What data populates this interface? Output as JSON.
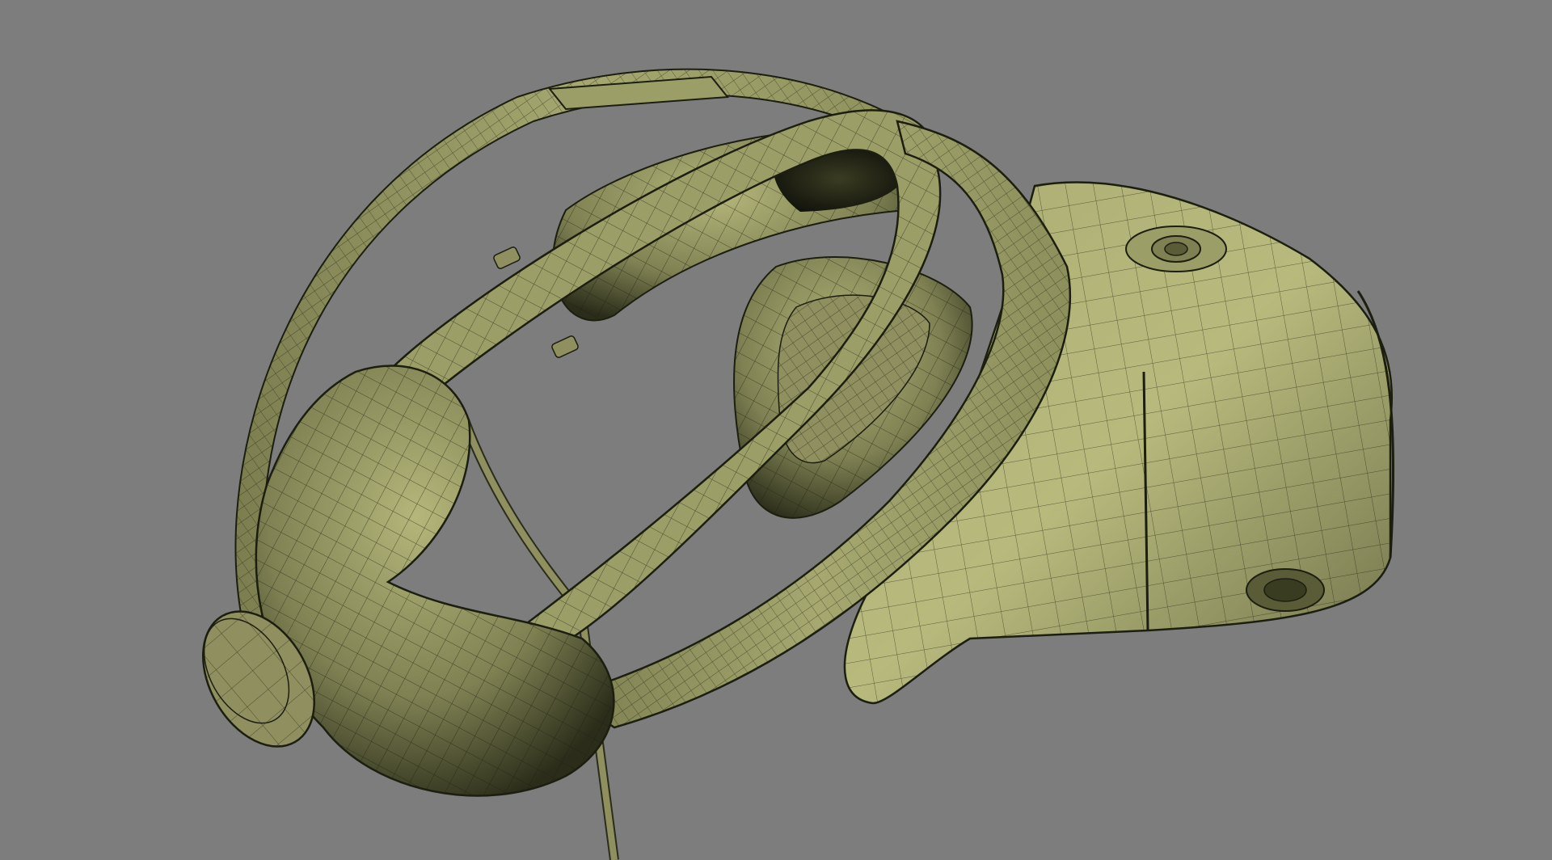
{
  "viewport": {
    "background_color": "#7d7d7d",
    "subject": "vr-headset-wireframe-model"
  },
  "model": {
    "surface_color": "#8f8f5f",
    "highlight_color": "#b4b67a",
    "shadow_color": "#2b2d1a",
    "wire_color": "#1c1e10"
  }
}
